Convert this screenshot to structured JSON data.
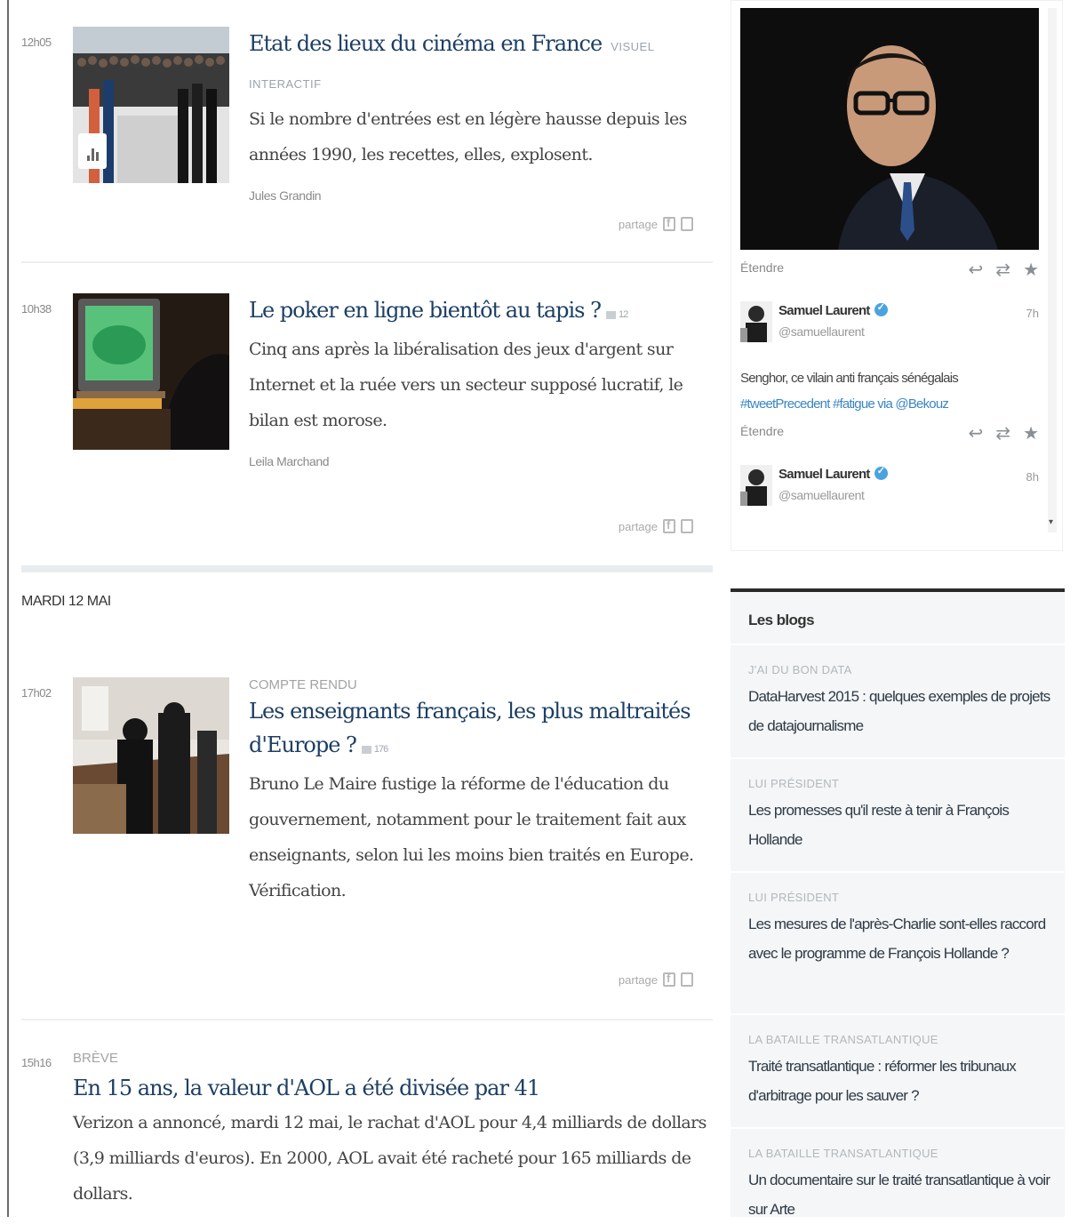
{
  "articles": [
    {
      "time": "12h05",
      "title": "Etat des lieux du cinéma en France",
      "tag": "VISUEL INTERACTIF",
      "description": "Si le nombre d'entrées est en légère hausse depuis les années 1990, les recettes, elles, explosent.",
      "author": "Jules Grandin",
      "share_label": "partage"
    },
    {
      "time": "10h38",
      "title": "Le poker en ligne bientôt au tapis ?",
      "comments": "12",
      "description": "Cinq ans après la libéralisation des jeux d'argent sur Internet et la ruée vers un secteur supposé lucratif, le bilan est morose.",
      "author": "Leila Marchand",
      "share_label": "partage"
    }
  ],
  "day_label": "MARDI 12 MAI",
  "articles_day2": [
    {
      "time": "17h02",
      "kicker": "COMPTE RENDU",
      "title_line1": "Les enseignants français, les plus maltraités",
      "title_line2": "d'Europe ?",
      "comments": "176",
      "description": "Bruno Le Maire fustige la réforme de l'éducation du gouvernement, notamment pour le traitement fait aux enseignants, selon lui les moins bien traités en Europe. Vérification.",
      "share_label": "partage"
    },
    {
      "time": "15h16",
      "kicker": "BRÈVE",
      "title": "En 15 ans, la valeur d'AOL a été divisée par 41",
      "description": "Verizon a annoncé, mardi 12 mai, le rachat d'AOL pour 4,4 milliards de dollars (3,9 milliards d'euros). En 2000, AOL avait été racheté pour 165 milliards de dollars."
    }
  ],
  "twitter": {
    "expand_label": "Étendre",
    "tweets": [
      {
        "name": "Samuel Laurent",
        "handle": "@samuellaurent",
        "time": "7h",
        "text": "Senghor, ce vilain anti français sénégalais",
        "links": "#tweetPrecedent #fatigue via @Bekouz"
      },
      {
        "name": "Samuel Laurent",
        "handle": "@samuellaurent",
        "time": "8h"
      }
    ]
  },
  "blogs": {
    "heading": "Les blogs",
    "items": [
      {
        "category": "J'AI DU BON DATA",
        "title": "DataHarvest 2015 : quelques exemples de projets de datajournalisme"
      },
      {
        "category": "LUI PRÉSIDENT",
        "title": "Les promesses qu'il reste à tenir à François Hollande"
      },
      {
        "category": "LUI PRÉSIDENT",
        "title": "Les mesures de l'après-Charlie sont-elles raccord avec le programme de François Hollande ?"
      },
      {
        "category": "LA BATAILLE TRANSATLANTIQUE",
        "title": "Traité transatlantique : réformer les tribunaux d'arbitrage pour les sauver ?"
      },
      {
        "category": "LA BATAILLE TRANSATLANTIQUE",
        "title": "Un documentaire sur le traité transatlantique à voir sur Arte"
      }
    ]
  }
}
